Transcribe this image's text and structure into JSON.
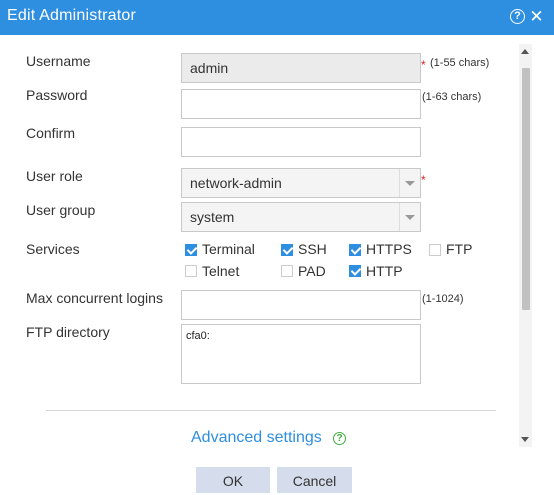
{
  "dialog": {
    "title": "Edit Administrator",
    "help_icon": "question-circle-icon",
    "close_icon": "close-icon"
  },
  "form": {
    "username": {
      "label": "Username",
      "value": "admin",
      "hint": "(1-55 chars)",
      "required_mark": "*"
    },
    "password": {
      "label": "Password",
      "value": "",
      "hint": "(1-63 chars)"
    },
    "confirm": {
      "label": "Confirm",
      "value": ""
    },
    "user_role": {
      "label": "User role",
      "value": "network-admin",
      "required_mark": "*"
    },
    "user_group": {
      "label": "User group",
      "value": "system"
    },
    "services": {
      "label": "Services",
      "items": [
        {
          "label": "Terminal",
          "checked": true
        },
        {
          "label": "SSH",
          "checked": true
        },
        {
          "label": "HTTPS",
          "checked": true
        },
        {
          "label": "FTP",
          "checked": false
        },
        {
          "label": "Telnet",
          "checked": false
        },
        {
          "label": "PAD",
          "checked": false
        },
        {
          "label": "HTTP",
          "checked": true
        }
      ]
    },
    "max_logins": {
      "label": "Max concurrent logins",
      "value": "",
      "hint": "(1-1024)"
    },
    "ftp_directory": {
      "label": "FTP directory",
      "value": "cfa0:"
    }
  },
  "advanced": {
    "label": "Advanced settings",
    "icon": "help-circle-green-icon"
  },
  "buttons": {
    "ok": "OK",
    "cancel": "Cancel"
  },
  "colors": {
    "accent": "#2e8ee0",
    "required": "#e02020",
    "button_bg": "#d5dcec"
  }
}
